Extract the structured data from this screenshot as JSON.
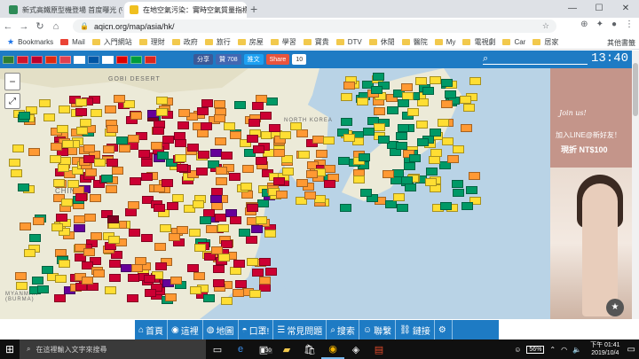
{
  "browser": {
    "tabs": [
      {
        "title": "新式高鐵原型機登場 首度曝光 (%",
        "active": false
      },
      {
        "title": "在地空氣污染：實時空氣質量指標",
        "active": true
      }
    ],
    "url": "aqicn.org/map/asia/hk/",
    "bookmarks": [
      "Bookmarks",
      "Mail",
      "入門網站",
      "理財",
      "政府",
      "旅行",
      "房屋",
      "學習",
      "寶貴",
      "DTV",
      "休閒",
      "醫院",
      "My",
      "電視劇",
      "Car",
      "居家"
    ],
    "other_bookmarks": "其他書籤"
  },
  "site": {
    "share_label": "分享",
    "like_label": "贊 708",
    "tweet_label": "推文",
    "share2_label": "Share",
    "share2_count": "10",
    "clock": "13:40",
    "flags": [
      "#2e7d32",
      "#cf142b",
      "#bc002d",
      "#de2910",
      "#e04050",
      "#ffffff",
      "#0055a4",
      "#ffffff",
      "#dd0000",
      "#009c3b",
      "#da251d"
    ],
    "map_labels": {
      "gobi": "GOBI DESERT",
      "china": "CHINA",
      "north_korea": "NORTH KOREA",
      "myanmar": "MYANMAR\n(BURMA)"
    },
    "menu": [
      {
        "icon": "home",
        "label": "首頁"
      },
      {
        "icon": "eye",
        "label": "這裡"
      },
      {
        "icon": "globe",
        "label": "地圖"
      },
      {
        "icon": "mask",
        "label": "口罩!"
      },
      {
        "icon": "chat",
        "label": "常見問題"
      },
      {
        "icon": "search",
        "label": "搜索"
      },
      {
        "icon": "people",
        "label": "聯繫"
      },
      {
        "icon": "link",
        "label": "鏈接"
      },
      {
        "icon": "gear",
        "label": ""
      }
    ]
  },
  "ad": {
    "script": "Join us!",
    "line1": "加入LINE@新好友！",
    "line2": "現折 NT$100"
  },
  "taskbar": {
    "search_placeholder": "在這裡輸入文字來搜尋",
    "battery": "56%",
    "time": "下午 01:41",
    "date": "2019/10/4",
    "badge": "30"
  }
}
